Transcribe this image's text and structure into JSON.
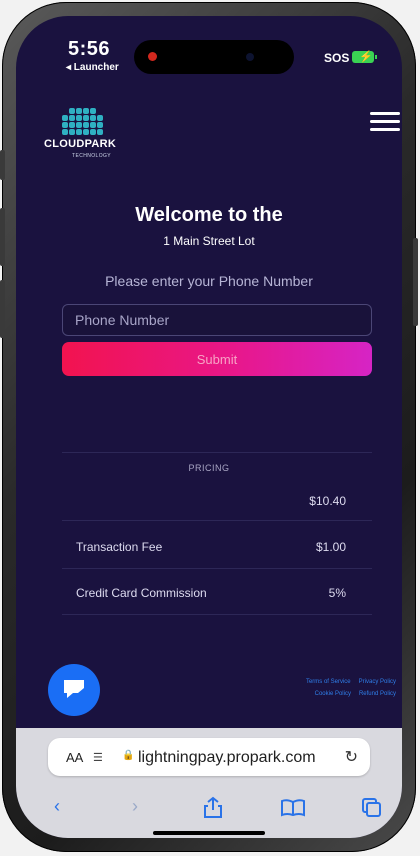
{
  "status": {
    "time": "5:56",
    "back_app": "◂ Launcher",
    "sos": "SOS"
  },
  "brand": {
    "name": "CLOUDPARK",
    "subtitle": "TECHNOLOGY"
  },
  "hero": {
    "title": "Welcome to the",
    "lot": "1 Main Street Lot",
    "prompt": "Please enter your Phone Number"
  },
  "form": {
    "phone_placeholder": "Phone Number",
    "phone_value": "",
    "submit_label": "Submit"
  },
  "pricing": {
    "title": "PRICING",
    "rows": [
      {
        "label": "",
        "value": "$10.40"
      },
      {
        "label": "Transaction Fee",
        "value": "$1.00"
      },
      {
        "label": "Credit Card Commission",
        "value": "5%"
      }
    ]
  },
  "footer": {
    "links": [
      "Terms of Service",
      "Privacy Policy",
      "Cookie Policy",
      "Refund Policy"
    ]
  },
  "browser": {
    "aa": "AA",
    "url": "lightningpay.propark.com"
  },
  "colors": {
    "page_bg": "#1a123f",
    "brand_teal": "#2fb0c2",
    "submit_gradient_start": "#f2134f",
    "submit_gradient_end": "#d624c5",
    "link_blue": "#2f7ee8",
    "chat_blue": "#1a6ef5"
  },
  "icons": {
    "menu": "hamburger-menu-icon",
    "chat": "chat-bubble-icon",
    "reload": "reload-icon",
    "back": "back-chevron-icon",
    "forward": "forward-chevron-icon",
    "share": "share-icon",
    "bookmarks": "bookmarks-icon",
    "tabs": "tabs-icon"
  }
}
